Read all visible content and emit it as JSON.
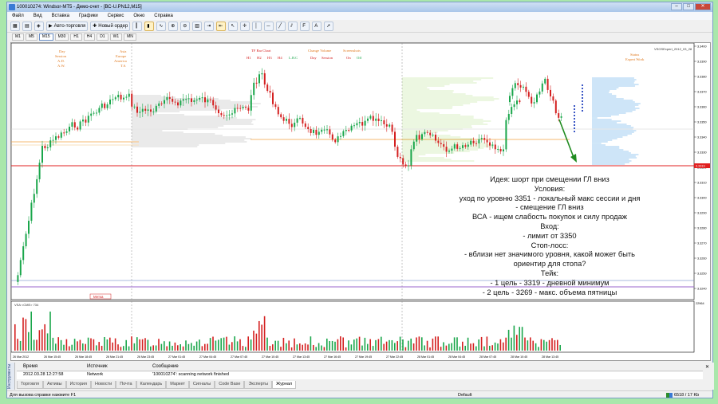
{
  "window": {
    "title": "100010274: Windsor-MT5 - Демо-счет - [ВС-U.PN12,M15]"
  },
  "menu": [
    "Файл",
    "Вид",
    "Вставка",
    "Графики",
    "Сервис",
    "Окно",
    "Справка"
  ],
  "toolbar": {
    "autotrade_label": "Авто-торговля",
    "new_order_label": "Новый ордер"
  },
  "timeframes": [
    "M1",
    "M5",
    "M15",
    "M30",
    "H1",
    "H4",
    "D1",
    "W1",
    "MN"
  ],
  "timeframes_selected": "M15",
  "chart": {
    "expert_label": "VSGSExpert_2012_03_28",
    "price_axis": [
      "3.3400",
      "3.3390",
      "3.3380",
      "3.3370",
      "3.3360",
      "3.3350",
      "3.3340",
      "3.3330",
      "3.3320",
      "3.3310",
      "3.3300",
      "3.3290",
      "3.3280",
      "3.3270",
      "3.3260",
      "3.3250",
      "3.3240"
    ],
    "current_price": "3.3319",
    "session_labels": {
      "day": "Day",
      "session": "Session",
      "ad": "A.D.",
      "aw": "A.W.",
      "asia": "Asia",
      "europe": "Europe",
      "america": "America",
      "ts": "T.S.",
      "tf_bar_chart": "TF Bar Chart",
      "tf_list": [
        "H1",
        "H2",
        "H3",
        "H4"
      ],
      "lbc": "L.B.C",
      "change_volume": "Change Volume",
      "cv_day": "Day",
      "cv_session": "Session",
      "screenshots": "Screenshots",
      "on": "On",
      "off": "Off",
      "status": "Status",
      "status_value": "Expert  Work"
    },
    "mark_label": "Метка",
    "volume_indicator_label": "VSA <CME> 734",
    "volume_axis_top": "22964",
    "time_axis": [
      "26 Mar 2012",
      "26 Mar 15:45",
      "26 Mar 18:45",
      "26 Mar 21:45",
      "26 Mar 23:45",
      "27 Mar 01:45",
      "27 Mar 04:45",
      "27 Mar 07:45",
      "27 Mar 10:45",
      "27 Mar 13:45",
      "27 Mar 16:45",
      "27 Mar 19:45",
      "27 Mar 22:45",
      "28 Mar 01:45",
      "28 Mar 04:45",
      "28 Mar 07:45",
      "28 Mar 10:45",
      "28 Mar 13:45"
    ]
  },
  "annotation": [
    "Идея: шорт при смещении ГЛ вниз",
    "Условия:",
    "уход по уровню 3351 - локальный макс сессии и дня",
    "- смещение ГЛ вниз",
    "ВСА - ищем слабость покупок и силу продаж",
    "Вход:",
    "- лимит от 3350",
    "Стоп-лосс:",
    "- вблизи нет значимого уровня, какой может быть",
    "ориентир для стопа?",
    "Тейк:",
    "- 1 цель - 3319 - дневной минимум",
    "- 2 цель - 3269 - макс. объема пятницы"
  ],
  "toolbox": {
    "panel_label": "Инструменты",
    "col_time": "Время",
    "col_source": "Источник",
    "col_message": "Сообщение",
    "log_time": "2012.03.28 12:27:58",
    "log_source": "Network",
    "log_message": "'100010274': scanning network finished",
    "tabs": [
      "Торговля",
      "Активы",
      "История",
      "Новости",
      "Почта",
      "Календарь",
      "Маркет",
      "Сигналы",
      "Code Base",
      "Эксперты",
      "Журнал"
    ],
    "active_tab": "Журнал"
  },
  "status": {
    "help": "Для вызова справки нажмите F1",
    "profile": "Default",
    "traffic": "6518 / 17 Kb"
  },
  "colors": {
    "bull": "#1aa64b",
    "bear": "#d42020",
    "support_line": "#e02020",
    "orange_line": "#f0a040",
    "purple_line": "#9966cc",
    "blue_profile": "#5aa9e6",
    "green_profile": "#9fd56a",
    "gray_profile": "#8a8a8a"
  }
}
